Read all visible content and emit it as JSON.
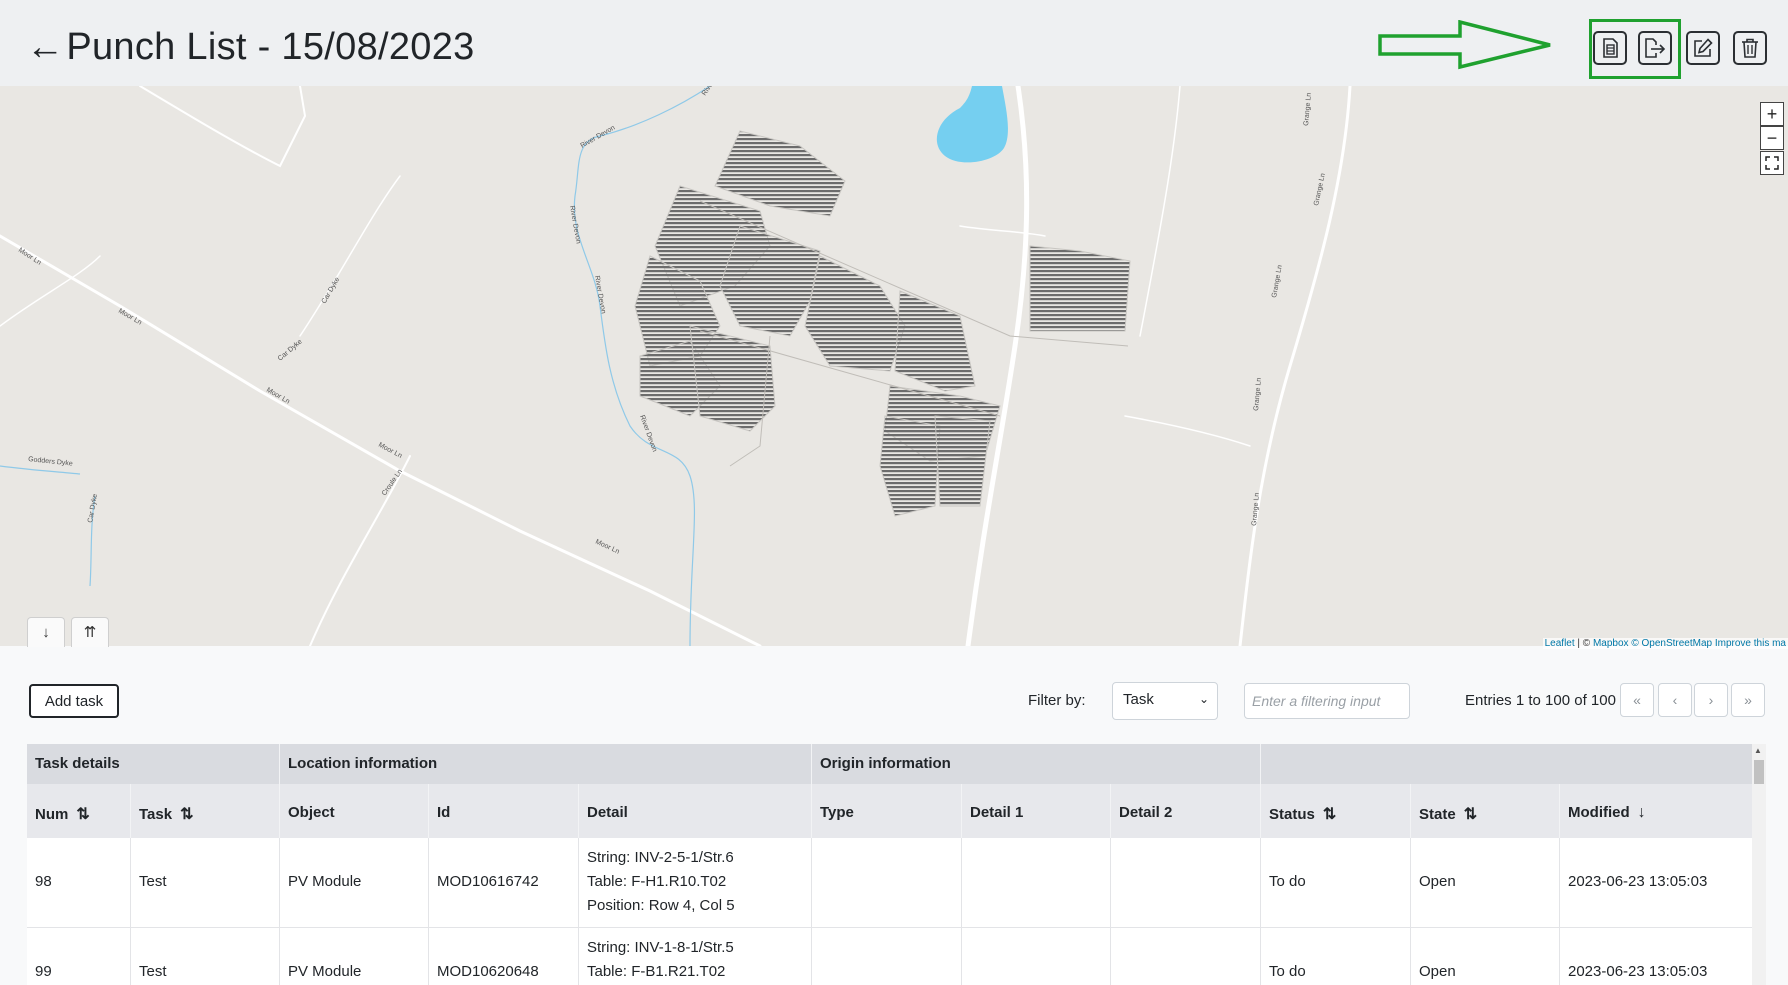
{
  "header": {
    "back_symbol": "←",
    "title": "Punch List - 15/08/2023",
    "actions": [
      {
        "name": "report-icon"
      },
      {
        "name": "export-icon"
      },
      {
        "name": "edit-icon"
      },
      {
        "name": "delete-icon"
      }
    ]
  },
  "map": {
    "zoom_in": "+",
    "zoom_out": "−",
    "fullscreen": "⛶",
    "panel_down": "↓",
    "panel_up": "⇈",
    "attribution_leaflet": "Leaflet",
    "attribution_sep": " | © ",
    "attribution_mapbox": "Mapbox",
    "attribution_osm": "© OpenStreetMap",
    "attribution_improve": "Improve this ma",
    "labels": [
      "Moor Ln",
      "Moor Ln",
      "Moor Ln",
      "Moor Ln",
      "Moor Ln",
      "Car Dyke",
      "Car Dyke",
      "Car Dyke",
      "Godders Dyke",
      "Croule Ln",
      "River Devon",
      "River Devon",
      "River Devon",
      "River Devon",
      "River Devon",
      "Grange Ln",
      "Grange Ln",
      "Grange Ln",
      "Grange Ln",
      "Grange Ln"
    ]
  },
  "controls": {
    "add_task": "Add task",
    "filter_label": "Filter by:",
    "filter_value": "Task",
    "filter_placeholder": "Enter a filtering input",
    "entries": "Entries 1 to 100 of 100",
    "pager": [
      "«",
      "‹",
      "›",
      "»"
    ]
  },
  "table": {
    "groups": [
      "Task details",
      "Location information",
      "Origin information",
      ""
    ],
    "columns": [
      {
        "label": "Num",
        "sort": "⇅"
      },
      {
        "label": "Task",
        "sort": "⇅"
      },
      {
        "label": "Object",
        "sort": ""
      },
      {
        "label": "Id",
        "sort": ""
      },
      {
        "label": "Detail",
        "sort": ""
      },
      {
        "label": "Type",
        "sort": ""
      },
      {
        "label": "Detail 1",
        "sort": ""
      },
      {
        "label": "Detail 2",
        "sort": ""
      },
      {
        "label": "Status",
        "sort": "⇅"
      },
      {
        "label": "State",
        "sort": "⇅"
      },
      {
        "label": "Modified",
        "sort": "↓"
      }
    ],
    "rows": [
      {
        "num": "98",
        "task": "Test",
        "object": "PV Module",
        "id": "MOD10616742",
        "detail": [
          "String: INV-2-5-1/Str.6",
          "Table: F-H1.R10.T02",
          "Position: Row 4, Col 5"
        ],
        "type": "",
        "detail1": "",
        "detail2": "",
        "status": "To do",
        "state": "Open",
        "modified": "2023-06-23 13:05:03"
      },
      {
        "num": "99",
        "task": "Test",
        "object": "PV Module",
        "id": "MOD10620648",
        "detail": [
          "String: INV-1-8-1/Str.5",
          "Table: F-B1.R21.T02",
          ""
        ],
        "type": "",
        "detail1": "",
        "detail2": "",
        "status": "To do",
        "state": "Open",
        "modified": "2023-06-23 13:05:03"
      }
    ]
  },
  "colors": {
    "highlight": "#1fa12f",
    "map_bg": "#e9e7e3",
    "water": "#75cff0",
    "header_bg": "#eef0f2"
  }
}
